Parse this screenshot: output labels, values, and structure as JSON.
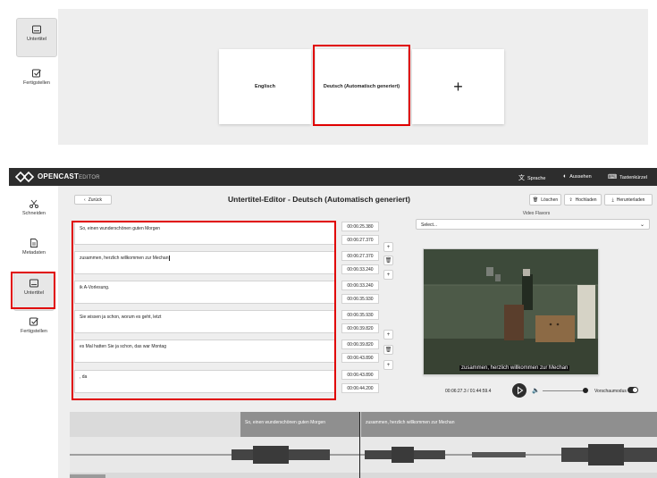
{
  "top_panel": {
    "sidebar": [
      {
        "label": "Untertitel",
        "icon": "subtitles-icon",
        "active": true
      },
      {
        "label": "Fertigstellen",
        "icon": "checkbox-icon",
        "active": false
      }
    ],
    "tiles": [
      {
        "label": "Englisch"
      },
      {
        "label": "Deutsch (Automatisch generiert)"
      },
      {
        "label": "+"
      }
    ]
  },
  "app": {
    "logo": {
      "brand": "OPENCAST",
      "suffix": "EDITOR"
    },
    "header": {
      "language": "Sprache",
      "appearance": "Aussehen",
      "shortcuts": "Tastenkürzel"
    },
    "sidebar": [
      {
        "label": "Schneiden",
        "icon": "scissors-icon"
      },
      {
        "label": "Metadaten",
        "icon": "document-icon"
      },
      {
        "label": "Untertitel",
        "icon": "subtitles-icon",
        "active": true
      },
      {
        "label": "Fertigstellen",
        "icon": "checkbox-icon"
      }
    ],
    "back_label": "Zurück",
    "title": "Untertitel-Editor - Deutsch (Automatisch generiert)",
    "actions": {
      "delete": "Löschen",
      "upload": "Hochladen",
      "download": "Herunterladen"
    },
    "segments": [
      {
        "text": "So, einen wunderschönen guten Morgen",
        "start": "00:06:25.380",
        "end": "00:06:27.370"
      },
      {
        "text": "zusammen, herzlich willkommen zur Mechan",
        "start": "00:06:27.370",
        "end": "00:06:33.240"
      },
      {
        "text": "ik A-Vorlesung.",
        "start": "00:06:33.240",
        "end": "00:06:35.930"
      },
      {
        "text": "Sie wissen ja schon, worum es geht, letzt",
        "start": "00:06:35.930",
        "end": "00:06:39.820"
      },
      {
        "text": "es Mal hatten Sie ja schon, das war Montag",
        "start": "00:06:39.820",
        "end": "00:06:43.890"
      },
      {
        "text": ", da",
        "start": "00:06:43.890",
        "end": "00:06:44.200"
      }
    ],
    "video": {
      "flavors_label": "Video Flavors",
      "select_value": "Select...",
      "caption": "zusammen, herzlich willkommen zur Mechan",
      "time": "00:06:27.3 / 01:44:59.4",
      "preview_label": "Vorschaumodus"
    },
    "timeline": {
      "segments": [
        "So, einen wunderschönen guten Morgen",
        "zusammen, herzlich willkommen zur Mechan"
      ]
    }
  },
  "colors": {
    "highlight": "#e00000",
    "header_bg": "#2d2d2d",
    "panel_bg": "#eeeeee"
  }
}
